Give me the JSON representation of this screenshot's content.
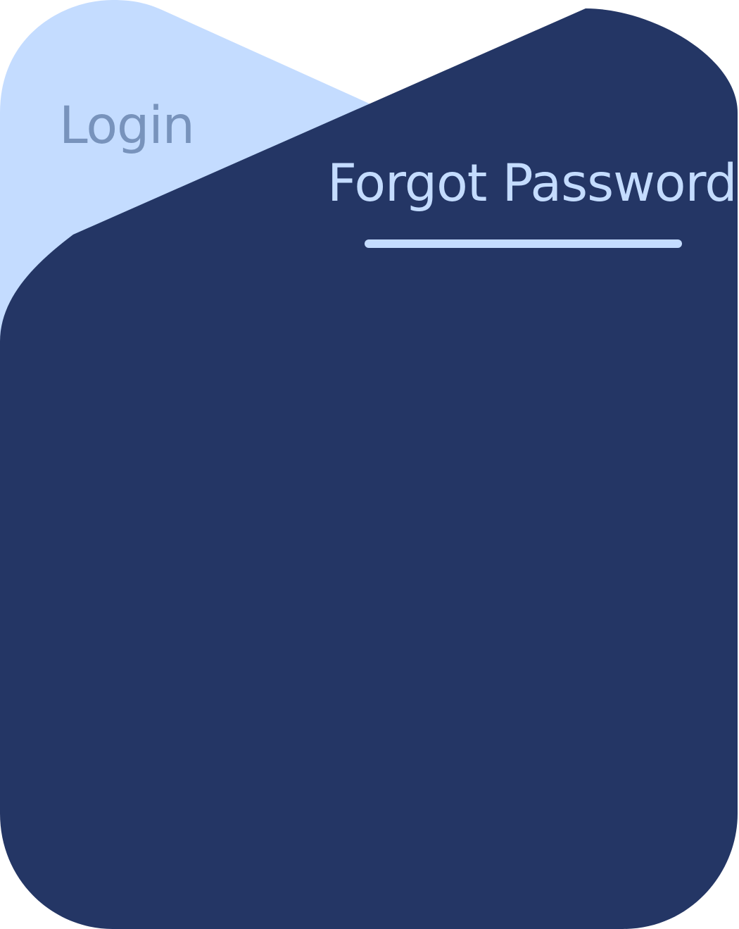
{
  "tabs": {
    "login": {
      "label": "Login",
      "active": false
    },
    "forgot_password": {
      "label": "Forgot Password",
      "active": true
    }
  },
  "colors": {
    "panel": "#243665",
    "inactive_tab_background": "#c4dcff",
    "inactive_tab_text": "#7893bc",
    "active_tab_text": "#c4dcff",
    "active_tab_indicator": "#c4dcff",
    "page_background": "#ffffff"
  }
}
